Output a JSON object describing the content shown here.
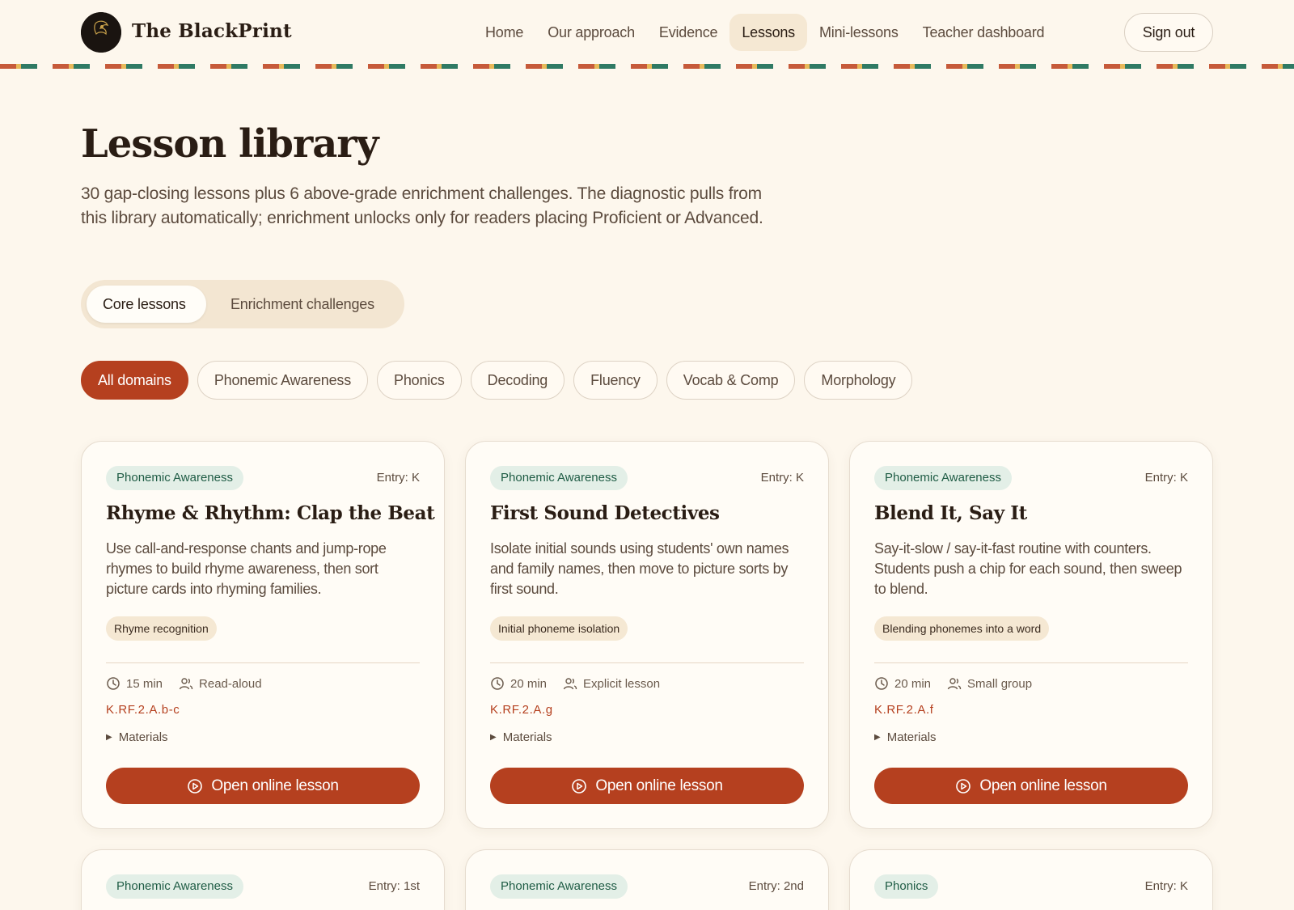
{
  "header": {
    "brand": "The BlackPrint",
    "logo_text": "BLACKPRINT",
    "nav": [
      {
        "label": "Home"
      },
      {
        "label": "Our approach"
      },
      {
        "label": "Evidence"
      },
      {
        "label": "Lessons",
        "active": true
      },
      {
        "label": "Mini-lessons"
      },
      {
        "label": "Teacher dashboard"
      }
    ],
    "signout_label": "Sign out"
  },
  "intro": {
    "title": "Lesson library",
    "description": "30 gap-closing lessons plus 6 above-grade enrichment challenges. The diagnostic pulls from this library automatically; enrichment unlocks only for readers placing Proficient or Advanced."
  },
  "segments": {
    "core": "Core lessons",
    "enrichment": "Enrichment challenges",
    "selected": "Core lessons"
  },
  "filters": [
    "All domains",
    "Phonemic Awareness",
    "Phonics",
    "Decoding",
    "Fluency",
    "Vocab & Comp",
    "Morphology"
  ],
  "selected_filter": "All domains",
  "colors": {
    "accent": "#b5401f",
    "background": "#fdf7ed",
    "tag_bg": "#e3efe7",
    "tag_text": "#1f5c45"
  },
  "cards": [
    {
      "domain": "Phonemic Awareness",
      "entry": "Entry: K",
      "title": "Rhyme & Rhythm: Clap the Beat",
      "description": "Use call-and-response chants and jump-rope rhymes to build rhyme awareness, then sort picture cards into rhyming families.",
      "skill": "Rhyme recognition",
      "duration": "15 min",
      "format": "Read-aloud",
      "standard": "K.RF.2.A.b-c",
      "materials_label": "Materials",
      "button_label": "Open online lesson"
    },
    {
      "domain": "Phonemic Awareness",
      "entry": "Entry: K",
      "title": "First Sound Detectives",
      "description": "Isolate initial sounds using students' own names and family names, then move to picture sorts by first sound.",
      "skill": "Initial phoneme isolation",
      "duration": "20 min",
      "format": "Explicit lesson",
      "standard": "K.RF.2.A.g",
      "materials_label": "Materials",
      "button_label": "Open online lesson"
    },
    {
      "domain": "Phonemic Awareness",
      "entry": "Entry: K",
      "title": "Blend It, Say It",
      "description": "Say-it-slow / say-it-fast routine with counters. Students push a chip for each sound, then sweep to blend.",
      "skill": "Blending phonemes into a word",
      "duration": "20 min",
      "format": "Small group",
      "standard": "K.RF.2.A.f",
      "materials_label": "Materials",
      "button_label": "Open online lesson"
    },
    {
      "domain": "Phonemic Awareness",
      "entry": "Entry: 1st"
    },
    {
      "domain": "Phonemic Awareness",
      "entry": "Entry: 2nd"
    },
    {
      "domain": "Phonics",
      "entry": "Entry: K"
    }
  ]
}
